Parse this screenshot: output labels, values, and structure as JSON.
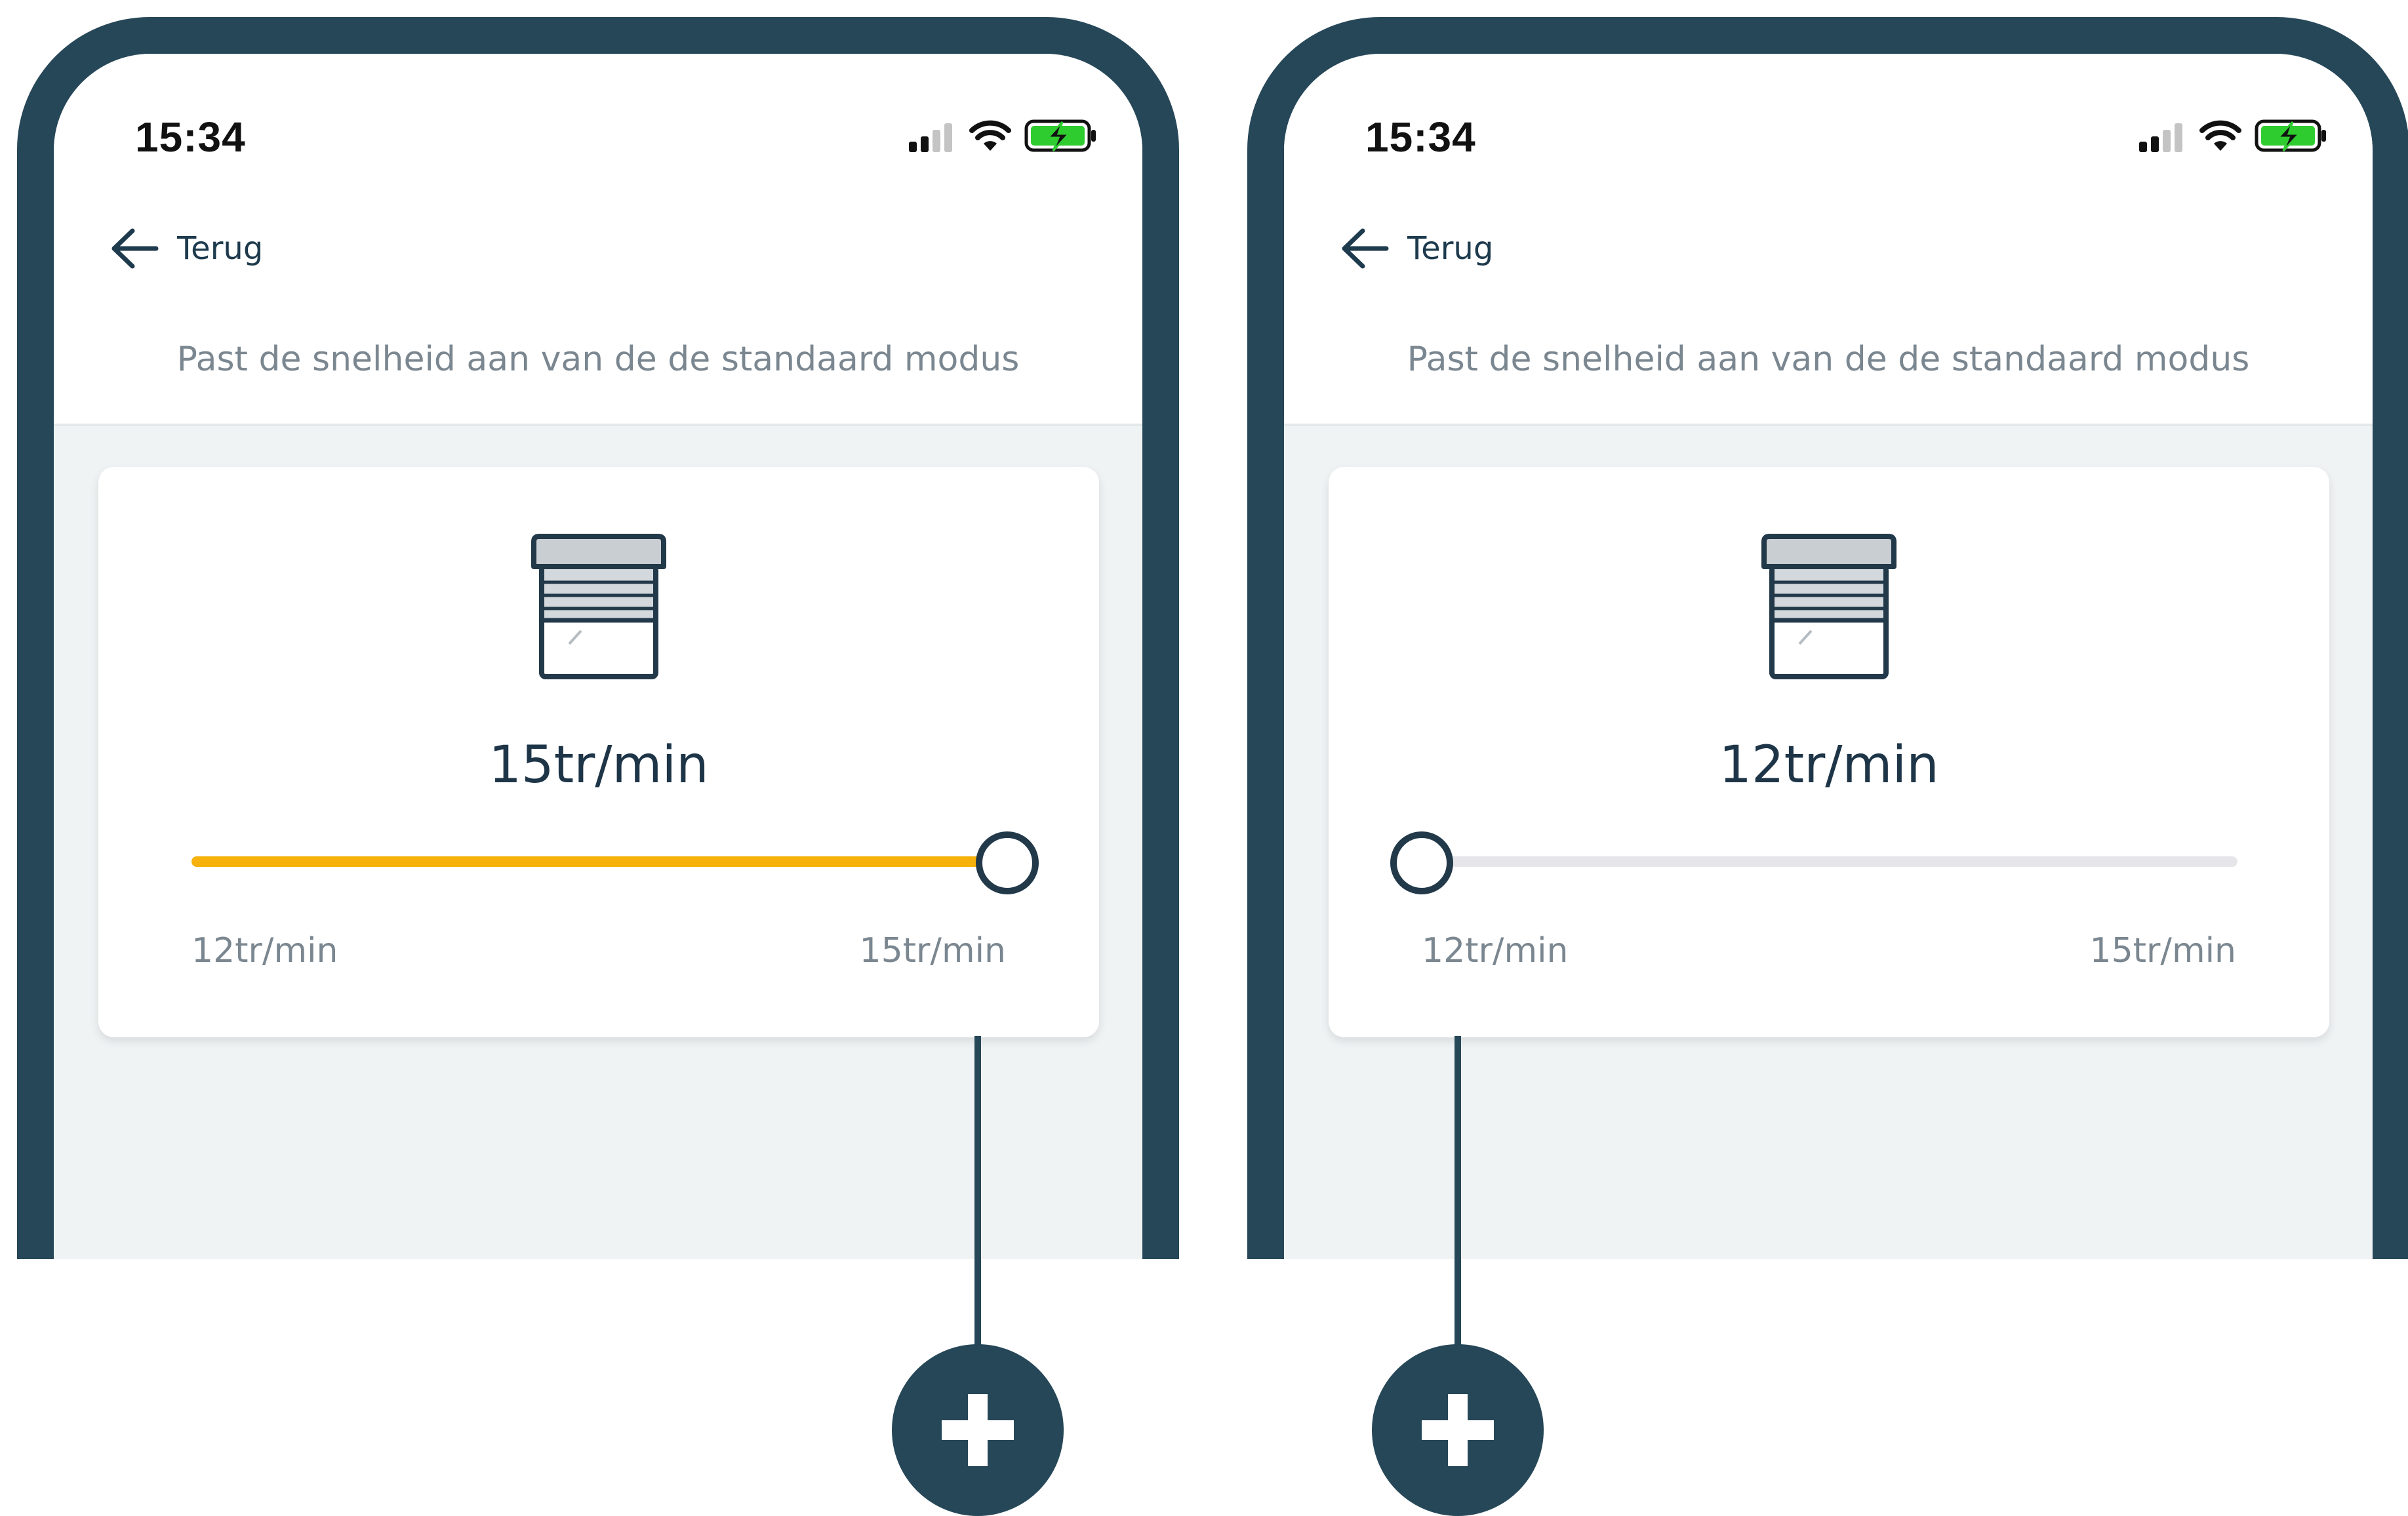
{
  "colors": {
    "frame": "#264758",
    "accent": "#f6b10b",
    "thumb_border": "#22394a",
    "battery_green": "#2fcc2f"
  },
  "screens": [
    {
      "status_bar": {
        "time": "15:34",
        "icons": [
          "cellular-signal-icon",
          "wifi-icon",
          "battery-charging-icon"
        ]
      },
      "nav": {
        "back_label": "Terug",
        "back_icon": "arrow-left-icon"
      },
      "subtitle": "Past de snelheid aan van de de standaard modus",
      "card": {
        "icon": "roller-shutter-icon",
        "value_label": "15tr/min",
        "slider": {
          "min": 12,
          "max": 15,
          "value": 15,
          "min_label": "12tr/min",
          "max_label": "15tr/min"
        }
      },
      "callout": {
        "icon": "plus-icon"
      }
    },
    {
      "status_bar": {
        "time": "15:34",
        "icons": [
          "cellular-signal-icon",
          "wifi-icon",
          "battery-charging-icon"
        ]
      },
      "nav": {
        "back_label": "Terug",
        "back_icon": "arrow-left-icon"
      },
      "subtitle": "Past de snelheid aan van de de standaard modus",
      "card": {
        "icon": "roller-shutter-icon",
        "value_label": "12tr/min",
        "slider": {
          "min": 12,
          "max": 15,
          "value": 12,
          "min_label": "12tr/min",
          "max_label": "15tr/min"
        }
      },
      "callout": {
        "icon": "plus-icon"
      }
    }
  ]
}
